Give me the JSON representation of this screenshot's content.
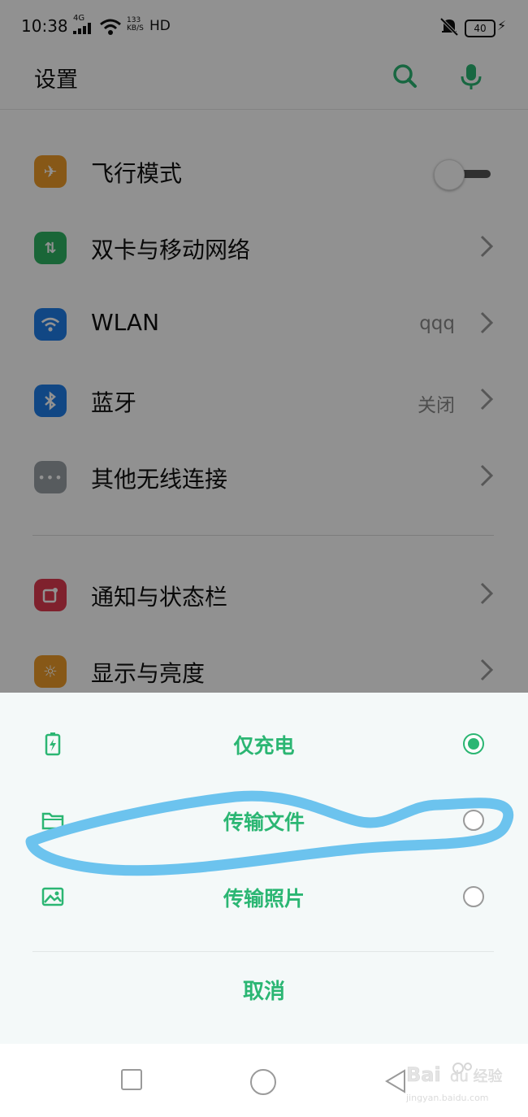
{
  "status_bar": {
    "time": "10:38",
    "network": "4G",
    "speed_value": "133",
    "speed_unit": "KB/S",
    "hd": "HD",
    "battery": "40"
  },
  "header": {
    "title": "设置"
  },
  "settings": {
    "items": [
      {
        "label": "飞行模式",
        "icon": "airplane-icon",
        "color": "#ee9c2a",
        "value": "",
        "control": "toggle-off"
      },
      {
        "label": "双卡与移动网络",
        "icon": "sim-data-icon",
        "color": "#2fb463",
        "value": "",
        "control": "chevron"
      },
      {
        "label": "WLAN",
        "icon": "wifi-icon",
        "color": "#1f7ee8",
        "value": "qqq",
        "control": "chevron"
      },
      {
        "label": "蓝牙",
        "icon": "bluetooth-icon",
        "color": "#1f7ee8",
        "value": "关闭",
        "control": "chevron"
      },
      {
        "label": "其他无线连接",
        "icon": "more-icon",
        "color": "#9aa0a6",
        "value": "",
        "control": "chevron"
      },
      {
        "label": "通知与状态栏",
        "icon": "notification-icon",
        "color": "#e03a4f",
        "value": "",
        "control": "chevron"
      },
      {
        "label": "显示与亮度",
        "icon": "brightness-icon",
        "color": "#ee9c2a",
        "value": "",
        "control": "chevron"
      }
    ]
  },
  "usb_sheet": {
    "options": [
      {
        "label": "仅充电",
        "icon": "battery-charge-icon",
        "selected": true
      },
      {
        "label": "传输文件",
        "icon": "folder-icon",
        "selected": false
      },
      {
        "label": "传输照片",
        "icon": "photo-icon",
        "selected": false
      }
    ],
    "cancel_label": "取消"
  },
  "colors": {
    "accent": "#2bb673",
    "annotation": "#6cc3ee"
  },
  "watermark": {
    "text": "Bai du 经验",
    "sub": "jingyan.baidu.com"
  }
}
